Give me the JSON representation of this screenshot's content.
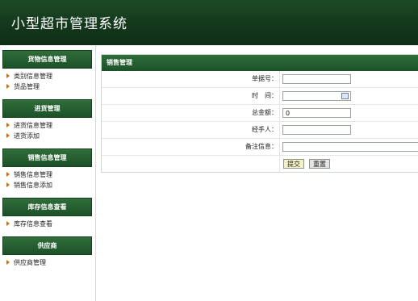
{
  "app": {
    "title": "小型超市管理系统"
  },
  "sidebar": {
    "sections": [
      {
        "title": "货物信息管理",
        "items": [
          "类别信息管理",
          "货品管理"
        ]
      },
      {
        "title": "进货管理",
        "items": [
          "进货信息管理",
          "进货添加"
        ]
      },
      {
        "title": "销售信息管理",
        "items": [
          "销售信息管理",
          "销售信息添加"
        ]
      },
      {
        "title": "库存信息查看",
        "items": [
          "库存信息查看"
        ]
      },
      {
        "title": "供应商",
        "items": [
          "供应商管理"
        ]
      }
    ]
  },
  "form": {
    "title": "销售管理",
    "fields": {
      "order_no": {
        "label": "单据号：",
        "value": ""
      },
      "time": {
        "label": "时　间：",
        "value": ""
      },
      "total": {
        "label": "总金额：",
        "value": "0"
      },
      "handler": {
        "label": "经手人：",
        "value": ""
      },
      "remark": {
        "label": "备注信息：",
        "value": ""
      }
    },
    "submit_label": "提交",
    "reset_label": "重置"
  },
  "icons": {
    "calendar": "calendar-icon",
    "arrow": "arrow-right-icon"
  },
  "colors": {
    "header": "#14381c",
    "section": "#1d5128",
    "arrow": "#d06a14"
  }
}
